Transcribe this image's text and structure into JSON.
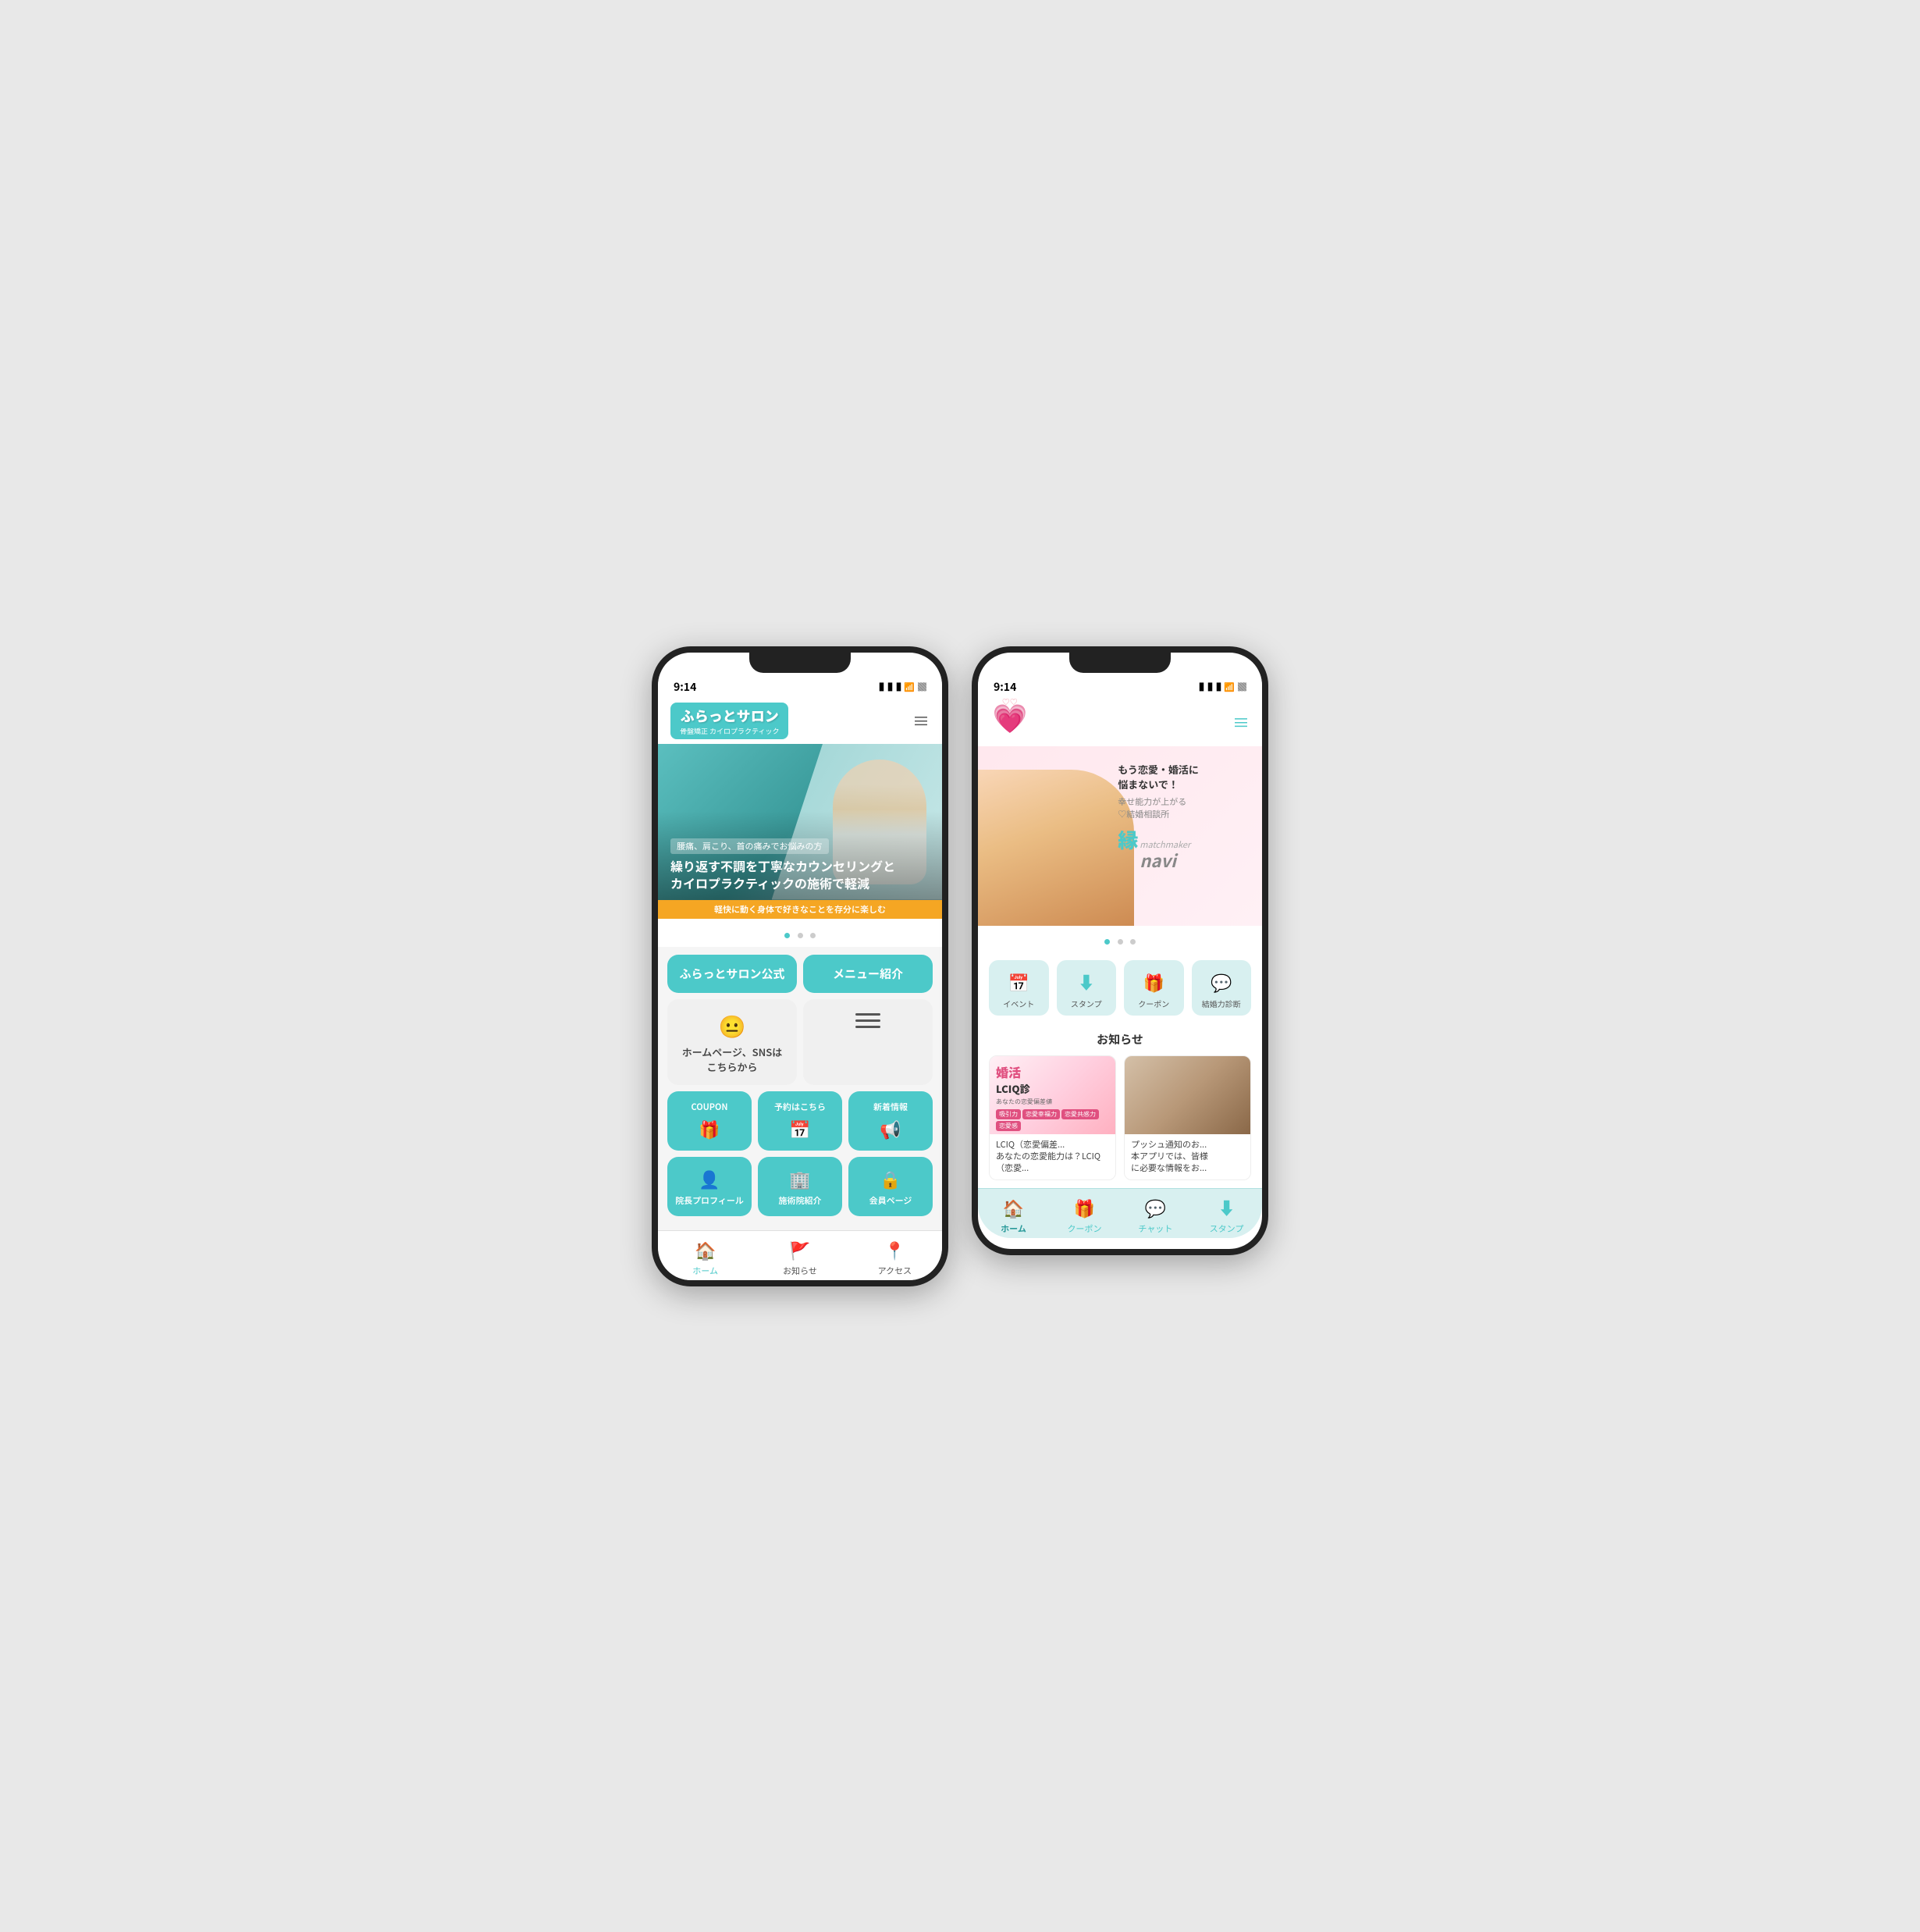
{
  "phone1": {
    "status": {
      "time": "9:14",
      "signal": "▐▐▐",
      "wifi": "WiFi",
      "battery": "🔋"
    },
    "header": {
      "logo_main": "ふらっとサロン",
      "logo_sub": "骨盤矯正 カイロプラクティック",
      "hamburger": "≡"
    },
    "hero": {
      "text1": "腰痛、肩こり、首の痛みでお悩みの方",
      "text2": "繰り返す不調を丁寧なカウンセリングと\nカイロプラクティックの施術で軽減",
      "banner": "軽快に動く身体で好きなことを存分に楽しむ"
    },
    "grid": {
      "btn1": "ふらっとサロン公式",
      "btn2": "メニュー紹介",
      "btn3_label": "ホームページ、SNSは\nこちらから",
      "btn4": "COUPON",
      "btn5": "予約はこちら",
      "btn6": "新着情報",
      "btn7": "院長プロフィール",
      "btn8": "施術院紹介",
      "btn9": "会員ページ"
    },
    "bottom_nav": {
      "home": "ホーム",
      "news": "お知らせ",
      "access": "アクセス"
    }
  },
  "phone2": {
    "status": {
      "time": "9:14",
      "signal": "▐▐▐",
      "wifi": "WiFi",
      "battery": "🔋"
    },
    "header": {
      "hamburger": "≡"
    },
    "hero": {
      "text1": "もう恋愛・婚活に\n悩まないで！",
      "text2": "幸せ能力が上がる\n♡結婚相談所",
      "brand_kanji": "縁",
      "brand_en": "matchmaker",
      "brand_navi": "navi"
    },
    "icon_grid": {
      "event": "イベント",
      "stamp": "スタンプ",
      "coupon": "クーポン",
      "diag": "結婚力診断"
    },
    "news": {
      "title": "お知らせ",
      "card1_title": "婚活",
      "card1_sub": "LCIQ診",
      "card1_tags": [
        "吸引力",
        "恋愛幸福力",
        "恋愛共感力",
        "恋愛感"
      ],
      "card1_desc": "LCIQ（恋愛偏差...\nあなたの恋愛能力は？LCIQ（恋愛...",
      "card2_desc": "プッシュ通知のお...\n本アプリでは、皆様\nに必要な情報をお..."
    },
    "bottom_nav": {
      "home": "ホーム",
      "coupon": "クーポン",
      "chat": "チャット",
      "stamp": "スタンプ"
    }
  }
}
